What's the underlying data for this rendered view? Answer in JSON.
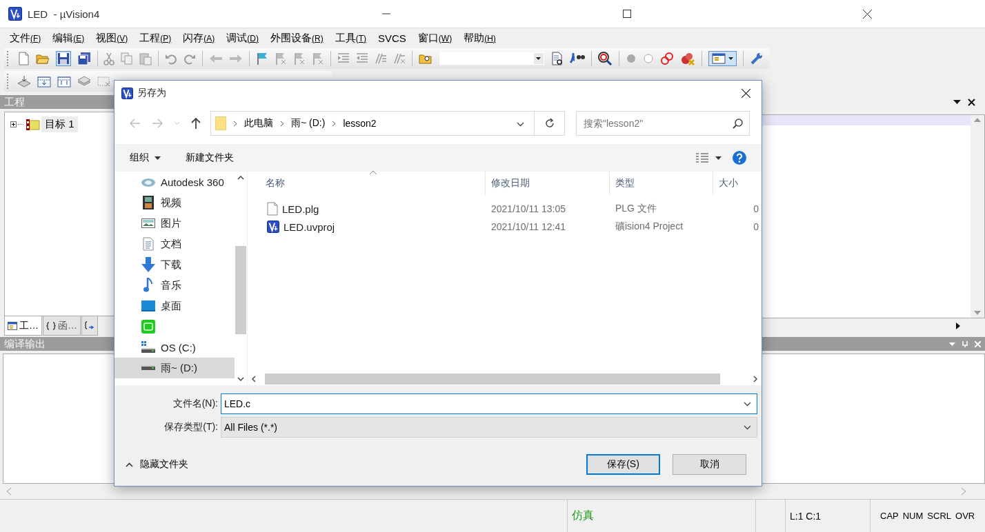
{
  "window": {
    "title": "LED  - µVision4"
  },
  "menu": [
    {
      "label": "文件",
      "accel": "(F)"
    },
    {
      "label": "编辑",
      "accel": "(E)"
    },
    {
      "label": "视图",
      "accel": "(V)"
    },
    {
      "label": "工程",
      "accel": "(P)"
    },
    {
      "label": "闪存",
      "accel": "(A)"
    },
    {
      "label": "调试",
      "accel": "(D)"
    },
    {
      "label": "外围设备",
      "accel": "(R)"
    },
    {
      "label": "工具",
      "accel": "(T)"
    },
    {
      "label": "SVCS"
    },
    {
      "label": "窗口",
      "accel": "(W)"
    },
    {
      "label": "帮助",
      "accel": "(H)"
    }
  ],
  "project_panel": {
    "title": "工程",
    "tree": [
      {
        "label": "目标 1",
        "expanded": false
      }
    ],
    "tabs": [
      {
        "label": "工…",
        "kind": "project",
        "selected": true
      },
      {
        "label": "函…",
        "kind": "functions",
        "selected": false
      },
      {
        "kind": "templates",
        "selected": false
      }
    ]
  },
  "output_panel": {
    "title": "编译输出"
  },
  "status_bar": {
    "mode": "仿真",
    "position": "L:1 C:1",
    "indicators": [
      "CAP",
      "NUM",
      "SCRL",
      "OVR"
    ]
  },
  "dialog": {
    "title": "另存为",
    "path": [
      "此电脑",
      "雨~ (D:)",
      "lesson2"
    ],
    "search": {
      "placeholder": "搜索\"lesson2\""
    },
    "commands": [
      "组织",
      "新建文件夹"
    ],
    "nav": [
      {
        "label": "Autodesk 360",
        "kind": "cloud",
        "selected": false
      },
      {
        "label": "视频",
        "kind": "video",
        "selected": false
      },
      {
        "label": "图片",
        "kind": "pictures",
        "selected": false
      },
      {
        "label": "文档",
        "kind": "documents",
        "selected": false
      },
      {
        "label": "下载",
        "kind": "downloads",
        "selected": false
      },
      {
        "label": "音乐",
        "kind": "music",
        "selected": false
      },
      {
        "label": "桌面",
        "kind": "desktop",
        "selected": false
      },
      {
        "kind": "app",
        "selected": false
      },
      {
        "label": "OS (C:)",
        "kind": "system-drive",
        "selected": false
      },
      {
        "label": "雨~ (D:)",
        "kind": "drive",
        "selected": true
      }
    ],
    "columns": [
      "名称",
      "修改日期",
      "类型",
      "大小"
    ],
    "files": [
      {
        "name": "LED.plg",
        "modified": "2021/10/11 13:05",
        "type": "PLG 文件",
        "size": "0",
        "kind": "text"
      },
      {
        "name": "LED.uvproj",
        "modified": "2021/10/11 12:41",
        "type": "礦ision4 Project",
        "size": "0",
        "kind": "project"
      }
    ],
    "filename": {
      "label": "文件名(N):",
      "value": "LED.c"
    },
    "filetype": {
      "label": "保存类型(T):",
      "value": "All Files (*.*)"
    },
    "hide_folders": "隐藏文件夹",
    "buttons": [
      {
        "label": "保存(S)",
        "default": true
      },
      {
        "label": "取消",
        "default": false
      }
    ]
  }
}
